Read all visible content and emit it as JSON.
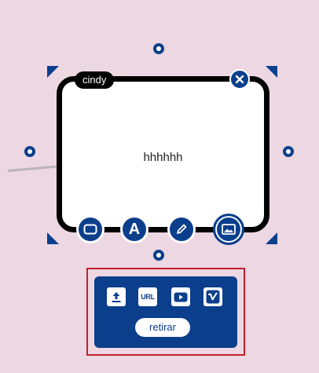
{
  "node": {
    "author": "cindy",
    "text": "hhhhhh"
  },
  "node_tools": [
    {
      "name": "shape",
      "icon": "rectangle-icon"
    },
    {
      "name": "text",
      "icon": "letter-a-icon",
      "glyph": "A"
    },
    {
      "name": "draw",
      "icon": "pencil-icon"
    },
    {
      "name": "image",
      "icon": "image-icon"
    }
  ],
  "media_popup": {
    "upload_icon": "upload-icon",
    "url_label": "URL",
    "youtube_icon": "youtube-icon",
    "vimeo_icon": "vimeo-icon",
    "remove_label": "retirar"
  },
  "colors": {
    "background": "#ecd7e3",
    "accent": "#0b3f8c",
    "node_border": "#000000",
    "highlight_frame": "#c0202a"
  }
}
